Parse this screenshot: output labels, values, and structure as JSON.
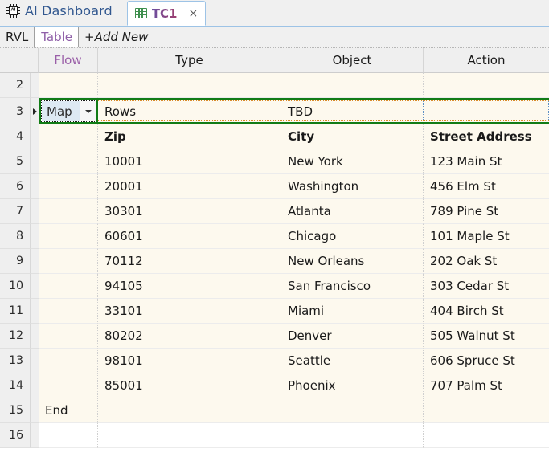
{
  "app": {
    "icon": "ai-chip-icon",
    "title": "AI Dashboard"
  },
  "document_tab": {
    "icon": "table-grid-icon",
    "name": "TC1",
    "close": "×"
  },
  "sheet_tabs": [
    {
      "label": "RVL",
      "active": false,
      "italic": false
    },
    {
      "label": "Table",
      "active": true,
      "italic": false
    },
    {
      "label": "+Add New",
      "active": false,
      "italic": true
    }
  ],
  "grid": {
    "columns": [
      {
        "key": "flow",
        "label": "Flow",
        "accent": "#9a5fa8"
      },
      {
        "key": "type",
        "label": "Type",
        "accent": "#1a1a1a"
      },
      {
        "key": "object",
        "label": "Object",
        "accent": "#1a1a1a"
      },
      {
        "key": "action",
        "label": "Action",
        "accent": "#1a1a1a"
      }
    ],
    "selection": {
      "row_number": "3",
      "border_color": "#127c16",
      "marker": "row-marker-triangle"
    },
    "editor": {
      "type": "dropdown",
      "value": "Map",
      "arrow": "chevron-down-icon"
    },
    "rows": [
      {
        "num": "2",
        "flow": "",
        "type": "",
        "object": "",
        "action": "",
        "style": "normal"
      },
      {
        "num": "3",
        "flow": "Map",
        "type": "Rows",
        "object": "TBD",
        "action": "",
        "style": "selected"
      },
      {
        "num": "4",
        "flow": "",
        "type": "Zip",
        "object": "City",
        "action": "Street Address",
        "style": "bold"
      },
      {
        "num": "5",
        "flow": "",
        "type": "10001",
        "object": "New York",
        "action": "123 Main St",
        "style": "normal"
      },
      {
        "num": "6",
        "flow": "",
        "type": "20001",
        "object": "Washington",
        "action": "456 Elm St",
        "style": "normal"
      },
      {
        "num": "7",
        "flow": "",
        "type": "30301",
        "object": "Atlanta",
        "action": "789 Pine St",
        "style": "normal"
      },
      {
        "num": "8",
        "flow": "",
        "type": "60601",
        "object": "Chicago",
        "action": "101 Maple St",
        "style": "normal"
      },
      {
        "num": "9",
        "flow": "",
        "type": "70112",
        "object": "New Orleans",
        "action": "202 Oak St",
        "style": "normal"
      },
      {
        "num": "10",
        "flow": "",
        "type": "94105",
        "object": "San Francisco",
        "action": "303 Cedar St",
        "style": "normal"
      },
      {
        "num": "11",
        "flow": "",
        "type": "33101",
        "object": "Miami",
        "action": "404 Birch St",
        "style": "normal"
      },
      {
        "num": "12",
        "flow": "",
        "type": "80202",
        "object": "Denver",
        "action": "505 Walnut St",
        "style": "normal"
      },
      {
        "num": "13",
        "flow": "",
        "type": "98101",
        "object": "Seattle",
        "action": "606 Spruce St",
        "style": "normal"
      },
      {
        "num": "14",
        "flow": "",
        "type": "85001",
        "object": "Phoenix",
        "action": "707 Palm St",
        "style": "normal"
      },
      {
        "num": "15",
        "flow": "End",
        "type": "",
        "object": "",
        "action": "",
        "style": "normal"
      },
      {
        "num": "16",
        "flow": "",
        "type": "",
        "object": "",
        "action": "",
        "style": "white"
      }
    ]
  },
  "colors": {
    "cell_background": "#fdf9ee",
    "header_background": "#efefef",
    "selection_green": "#127c16",
    "flow_accent": "#9a5fa8",
    "app_title": "#31578f",
    "tab_name": "#8f3f7e"
  }
}
